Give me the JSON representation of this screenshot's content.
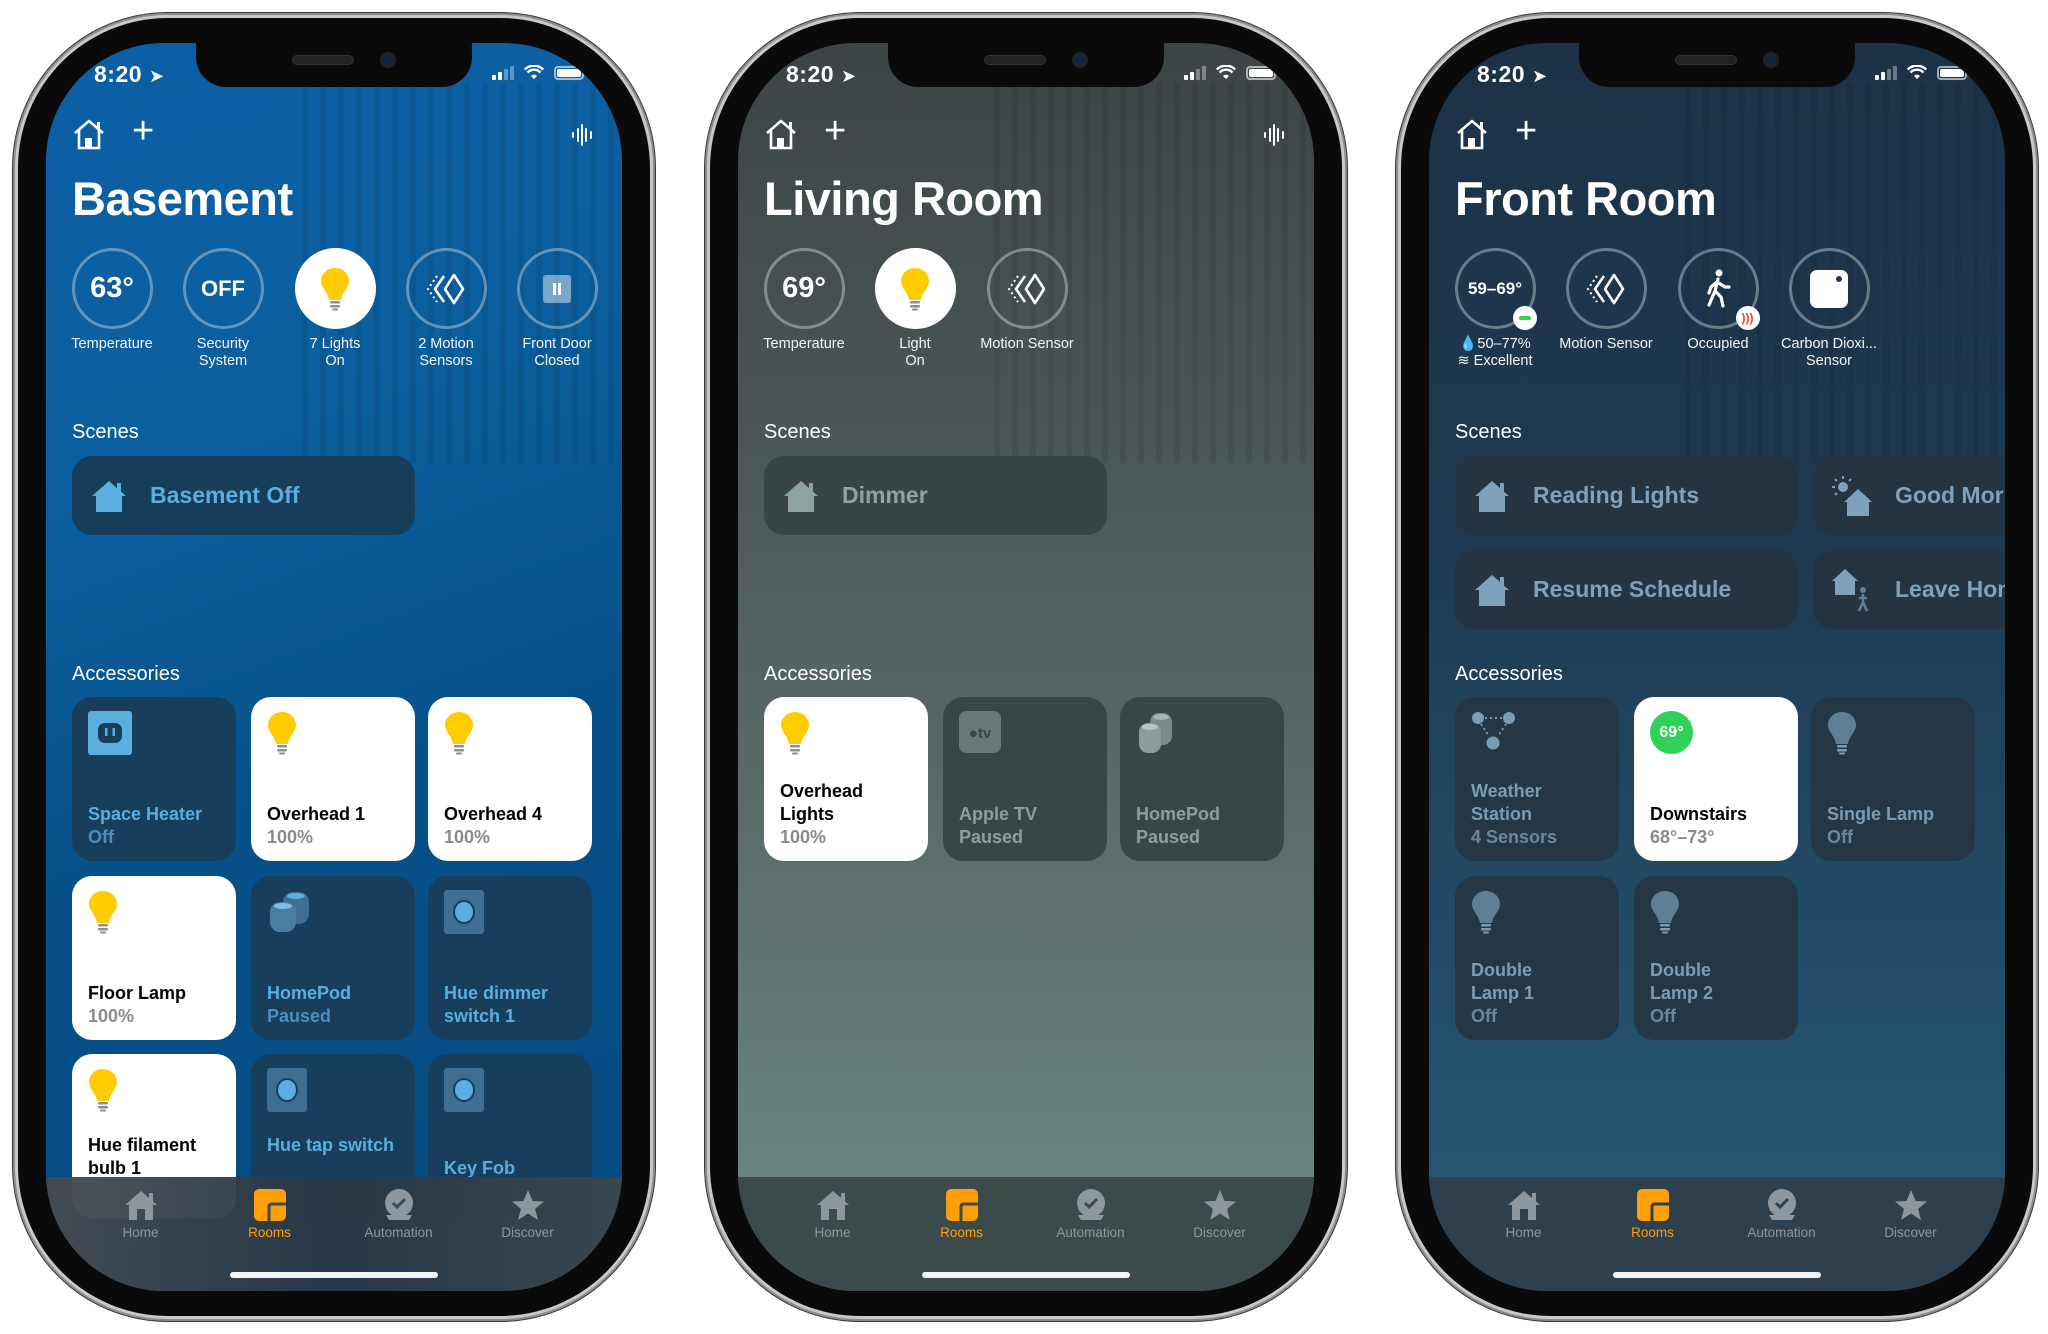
{
  "status_bar": {
    "time": "8:20"
  },
  "phones": [
    {
      "room_title": "Basement",
      "status_items": [
        {
          "value": "63°",
          "label_line1": "Temperature",
          "label_line2": ""
        },
        {
          "value": "OFF",
          "label_line1": "Security",
          "label_line2": "System"
        },
        {
          "value": "",
          "label_line1": "7 Lights",
          "label_line2": "On"
        },
        {
          "value": "",
          "label_line1": "2 Motion",
          "label_line2": "Sensors"
        },
        {
          "value": "",
          "label_line1": "Front Door",
          "label_line2": "Closed"
        }
      ],
      "scenes_label": "Scenes",
      "scenes": [
        {
          "label": "Basement Off"
        }
      ],
      "accessories_label": "Accessories",
      "accessories": [
        {
          "name": "Space Heater",
          "status": "Off",
          "icon": "outlet-icon",
          "on": false
        },
        {
          "name": "Overhead 1",
          "status": "100%",
          "icon": "lightbulb-icon",
          "on": true
        },
        {
          "name": "Overhead 4",
          "status": "100%",
          "icon": "lightbulb-icon",
          "on": true
        },
        {
          "name": "Floor Lamp",
          "status": "100%",
          "icon": "lightbulb-icon",
          "on": true
        },
        {
          "name": "HomePod",
          "status": "Paused",
          "icon": "homepod-icon",
          "on": false
        },
        {
          "name": "Hue dimmer switch 1",
          "status": "",
          "icon": "switch-icon",
          "on": false
        },
        {
          "name": "Hue filament bulb 1",
          "status": "",
          "icon": "lightbulb-icon",
          "on": true
        },
        {
          "name": "Hue tap switch",
          "status": "",
          "icon": "switch-icon",
          "on": false
        },
        {
          "name": "Key Fob",
          "status": "",
          "icon": "switch-icon",
          "on": false
        }
      ]
    },
    {
      "room_title": "Living Room",
      "status_items": [
        {
          "value": "69°",
          "label_line1": "Temperature",
          "label_line2": ""
        },
        {
          "value": "",
          "label_line1": "Light",
          "label_line2": "On"
        },
        {
          "value": "",
          "label_line1": "Motion Sensor",
          "label_line2": ""
        }
      ],
      "scenes_label": "Scenes",
      "scenes": [
        {
          "label": "Dimmer"
        }
      ],
      "accessories_label": "Accessories",
      "accessories": [
        {
          "name": "Overhead Lights",
          "status": "100%",
          "icon": "lightbulb-icon",
          "on": true
        },
        {
          "name": "Apple TV",
          "status": "Paused",
          "icon": "appletv-icon",
          "on": false
        },
        {
          "name": "HomePod",
          "status": "Paused",
          "icon": "homepod-icon",
          "on": false
        }
      ]
    },
    {
      "room_title": "Front Room",
      "status_items": [
        {
          "value": "59–69°",
          "label_line1": "50–77%",
          "label_line2": "Excellent"
        },
        {
          "value": "",
          "label_line1": "Motion Sensor",
          "label_line2": ""
        },
        {
          "value": "",
          "label_line1": "Occupied",
          "label_line2": ""
        },
        {
          "value": "",
          "label_line1": "Carbon Dioxi...",
          "label_line2": "Sensor"
        }
      ],
      "scenes_label": "Scenes",
      "scenes": [
        {
          "label": "Reading Lights"
        },
        {
          "label": "Good Morning"
        },
        {
          "label": "Resume Schedule"
        },
        {
          "label": "Leave Home"
        }
      ],
      "accessories_label": "Accessories",
      "accessories": [
        {
          "name": "Weather Station",
          "status": "4 Sensors",
          "icon": "sensor-group-icon",
          "on": false
        },
        {
          "name": "Downstairs",
          "status": "68°–73°",
          "icon": "thermostat-icon",
          "badge": "69°",
          "on": true
        },
        {
          "name": "Single Lamp",
          "status": "Off",
          "icon": "lightbulb-icon",
          "on": false
        },
        {
          "name": "Double Lamp 1",
          "status": "Off",
          "icon": "lightbulb-icon",
          "on": false
        },
        {
          "name": "Double Lamp 2",
          "status": "Off",
          "icon": "lightbulb-icon",
          "on": false
        }
      ]
    }
  ],
  "tabbar": [
    {
      "label": "Home",
      "icon": "home-icon",
      "active": false
    },
    {
      "label": "Rooms",
      "icon": "rooms-icon",
      "active": true
    },
    {
      "label": "Automation",
      "icon": "automation-icon",
      "active": false
    },
    {
      "label": "Discover",
      "icon": "star-icon",
      "active": false
    }
  ],
  "colors": {
    "accent": "#ff9f0a",
    "bulb_on": "#ffcc00",
    "good_badge": "#30d158",
    "alert": "#ff3b30"
  }
}
